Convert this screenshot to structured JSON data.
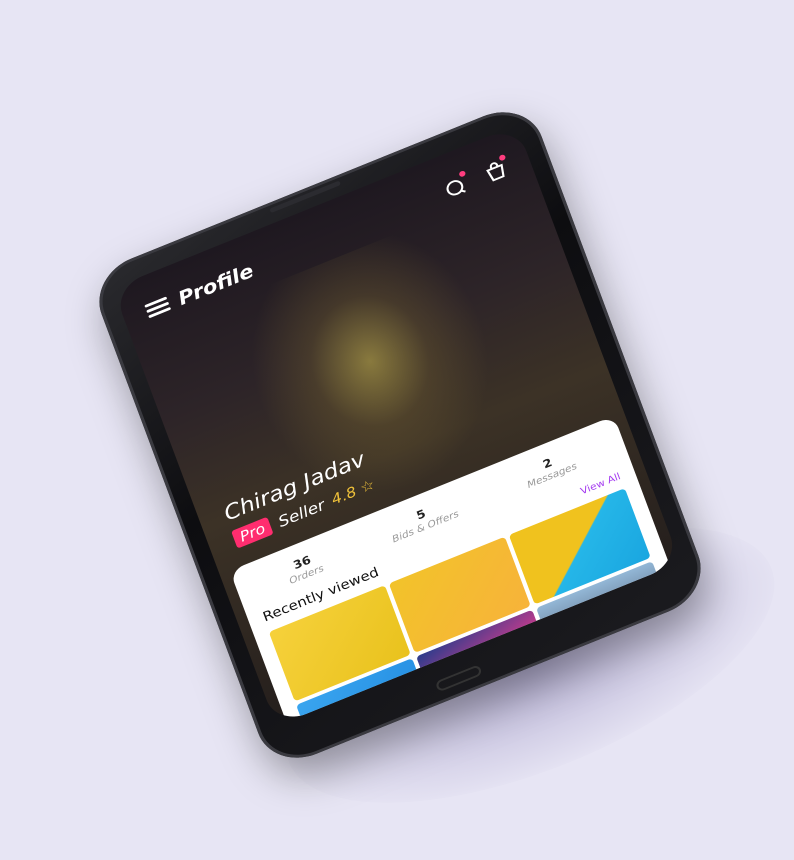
{
  "header": {
    "title": "Profile"
  },
  "profile": {
    "name": "Chirag Jadav",
    "badge": "Pro",
    "role": "Seller",
    "rating": "4.8 ☆"
  },
  "stats": [
    {
      "value": "36",
      "label": "Orders"
    },
    {
      "value": "5",
      "label": "Bids & Offers"
    },
    {
      "value": "2",
      "label": "Messages"
    }
  ],
  "recently_viewed": {
    "title": "Recently viewed",
    "view_all": "View All"
  },
  "colors": {
    "accent": "#ff2d6f",
    "link": "#a53df0",
    "rating": "#f0c23a"
  }
}
